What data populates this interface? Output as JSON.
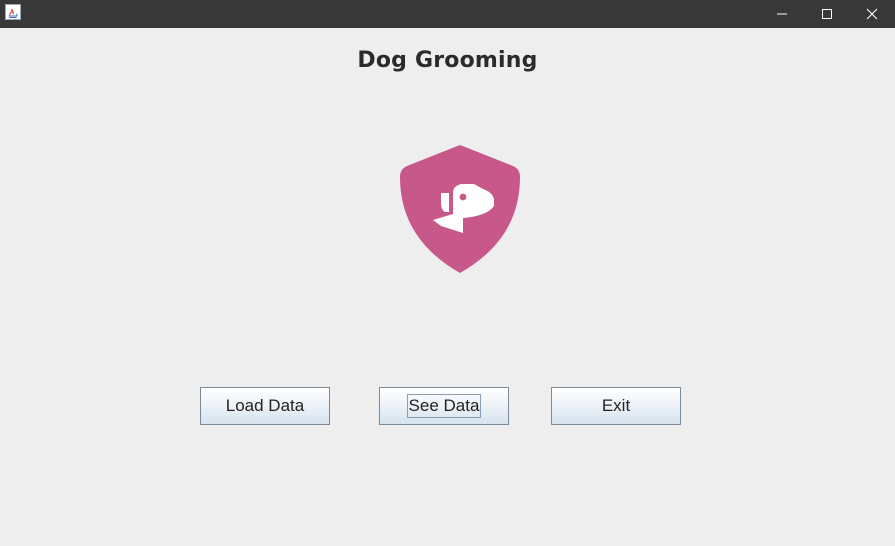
{
  "window": {
    "title": "",
    "controls": {
      "minimize": "minimize-icon",
      "maximize": "maximize-icon",
      "close": "close-icon"
    }
  },
  "header": {
    "title": "Dog Grooming"
  },
  "logo": {
    "icon": "dog-shield-logo",
    "color": "#c9588a"
  },
  "buttons": {
    "load_label": "Load Data",
    "see_label": "See Data",
    "exit_label": "Exit"
  },
  "colors": {
    "titlebar": "#383838",
    "background": "#eeeeee",
    "accent": "#c9588a"
  }
}
